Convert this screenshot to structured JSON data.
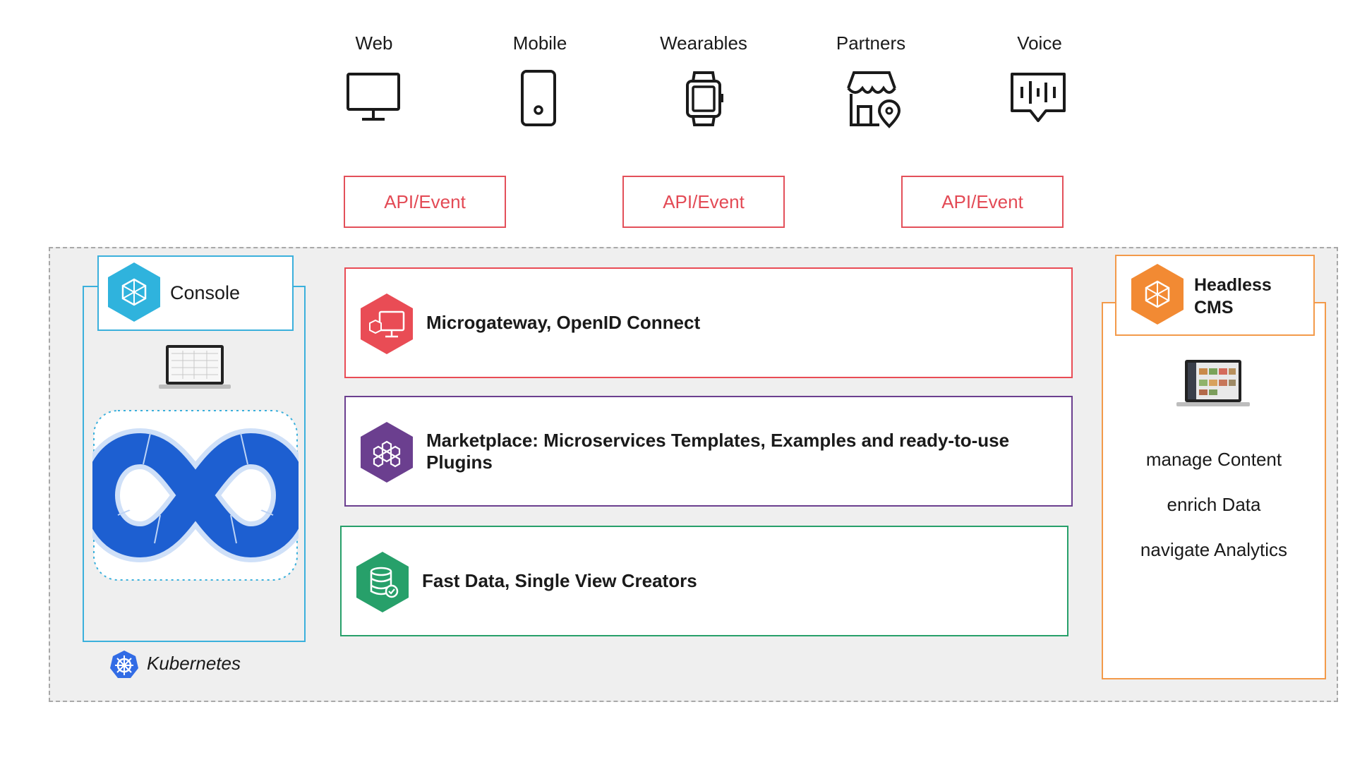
{
  "channels": [
    {
      "label": "Web",
      "icon": "monitor-icon"
    },
    {
      "label": "Mobile",
      "icon": "smartphone-icon"
    },
    {
      "label": "Wearables",
      "icon": "smartwatch-icon"
    },
    {
      "label": "Partners",
      "icon": "storefront-location-icon"
    },
    {
      "label": "Voice",
      "icon": "voice-bubble-icon"
    }
  ],
  "api_boxes": [
    "API/Event",
    "API/Event",
    "API/Event"
  ],
  "console": {
    "title": "Console",
    "icon": "console-hexagon-icon"
  },
  "kubernetes": {
    "label": "Kubernetes",
    "icon": "kubernetes-helm-icon"
  },
  "services": [
    {
      "label": "Microgateway, OpenID Connect",
      "color": "#e94c55",
      "icon": "microgateway-icon"
    },
    {
      "label": "Marketplace: Microservices Templates, Examples and ready-to-use Plugins",
      "color": "#6b3f8f",
      "icon": "marketplace-icon"
    },
    {
      "label": "Fast Data, Single View Creators",
      "color": "#27a06a",
      "icon": "database-check-icon"
    }
  ],
  "cms": {
    "title_line1": "Headless",
    "title_line2": "CMS",
    "icon": "cms-hexagon-icon",
    "items": [
      "manage Content",
      "enrich Data",
      "navigate Analytics"
    ]
  },
  "colors": {
    "api_red": "#e3505a",
    "console_blue": "#3bb0dc",
    "cms_orange": "#f39a4a",
    "devops_blue": "#1d5fd1"
  }
}
